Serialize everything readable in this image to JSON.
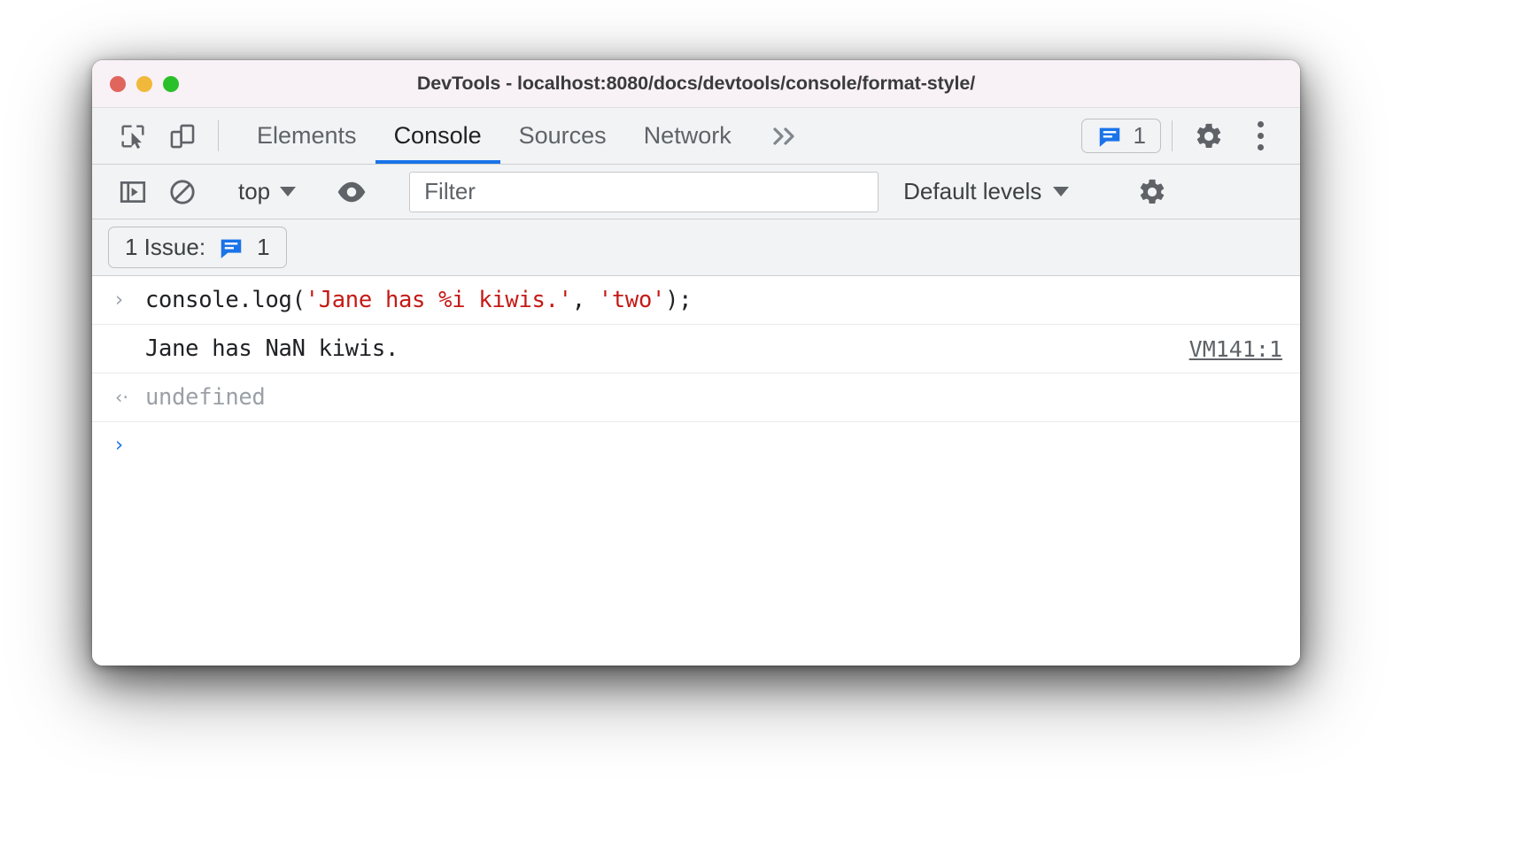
{
  "window": {
    "title": "DevTools - localhost:8080/docs/devtools/console/format-style/",
    "traffic_lights": [
      "close",
      "minimize",
      "maximize"
    ]
  },
  "tabbar": {
    "inspect_icon": "inspect-element-icon",
    "device_icon": "device-toolbar-icon",
    "tabs": [
      {
        "label": "Elements",
        "active": false
      },
      {
        "label": "Console",
        "active": true
      },
      {
        "label": "Sources",
        "active": false
      },
      {
        "label": "Network",
        "active": false
      }
    ],
    "overflow_label": "»",
    "issues_count": "1",
    "issues_icon": "issues-speech-bubble-icon",
    "settings_icon": "gear-icon",
    "more_icon": "more-vertical-icon"
  },
  "console_toolbar": {
    "sidebar_icon": "console-sidebar-icon",
    "clear_icon": "clear-console-icon",
    "context_label": "top",
    "eye_icon": "live-expression-eye-icon",
    "filter_placeholder": "Filter",
    "filter_value": "",
    "levels_label": "Default levels",
    "settings_icon": "console-settings-gear-icon"
  },
  "issues_bar": {
    "label": "1 Issue:",
    "icon": "issues-speech-bubble-icon",
    "count": "1"
  },
  "console_messages": [
    {
      "type": "input",
      "gutter": "›",
      "parts": [
        {
          "text": "console.log(",
          "style": "plain"
        },
        {
          "text": "'Jane has %i kiwis.'",
          "style": "string"
        },
        {
          "text": ", ",
          "style": "plain"
        },
        {
          "text": "'two'",
          "style": "string"
        },
        {
          "text": ");",
          "style": "plain"
        }
      ],
      "link": ""
    },
    {
      "type": "output",
      "gutter": "",
      "text": "Jane has NaN kiwis.",
      "link": "VM141:1"
    },
    {
      "type": "result",
      "gutter": "‹·",
      "text": "undefined",
      "link": ""
    }
  ],
  "prompt": {
    "symbol": "›",
    "value": ""
  },
  "colors": {
    "accent": "#1a73e8",
    "string": "#c41a16",
    "toolbar_bg": "#f1f3f4",
    "titlebar_bg": "#f8f1f6",
    "text": "#202124",
    "muted": "#5f6368"
  }
}
